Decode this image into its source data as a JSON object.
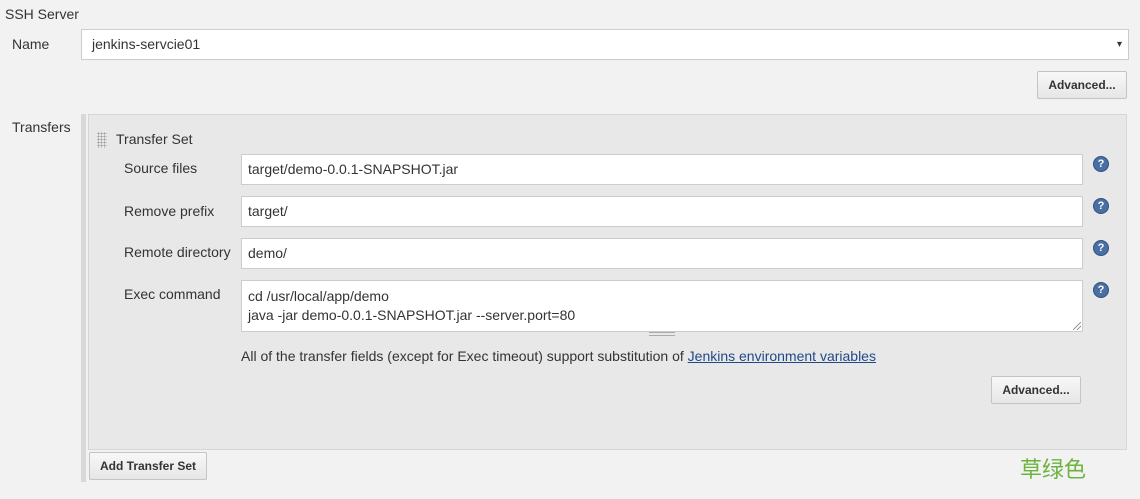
{
  "section": {
    "title": "SSH Server"
  },
  "name_field": {
    "label": "Name",
    "selected": "jenkins-servcie01",
    "arrow": "▾"
  },
  "server_advanced_button": {
    "label": "Advanced..."
  },
  "transfers": {
    "label": "Transfers",
    "transfer_set": {
      "title": "Transfer Set",
      "fields": {
        "source_files": {
          "label": "Source files",
          "value": "target/demo-0.0.1-SNAPSHOT.jar"
        },
        "remove_prefix": {
          "label": "Remove prefix",
          "value": "target/"
        },
        "remote_directory": {
          "label": "Remote directory",
          "value": "demo/"
        },
        "exec_command": {
          "label": "Exec command",
          "value": "cd /usr/local/app/demo\njava -jar demo-0.0.1-SNAPSHOT.jar --server.port=80"
        }
      },
      "note_text": "All of the transfer fields (except for Exec timeout) support substitution of ",
      "note_link": "Jenkins environment variables",
      "advanced_button": {
        "label": "Advanced..."
      }
    },
    "add_button": {
      "label": "Add Transfer Set"
    }
  },
  "help_icon_glyph": "?",
  "watermark": "草绿色",
  "colors": {
    "page_background": "#f2f2f2",
    "panel_background": "#e8e8e8",
    "help_icon": "#4a6fa5",
    "link": "#204a87",
    "watermark": "#6cb33e"
  }
}
